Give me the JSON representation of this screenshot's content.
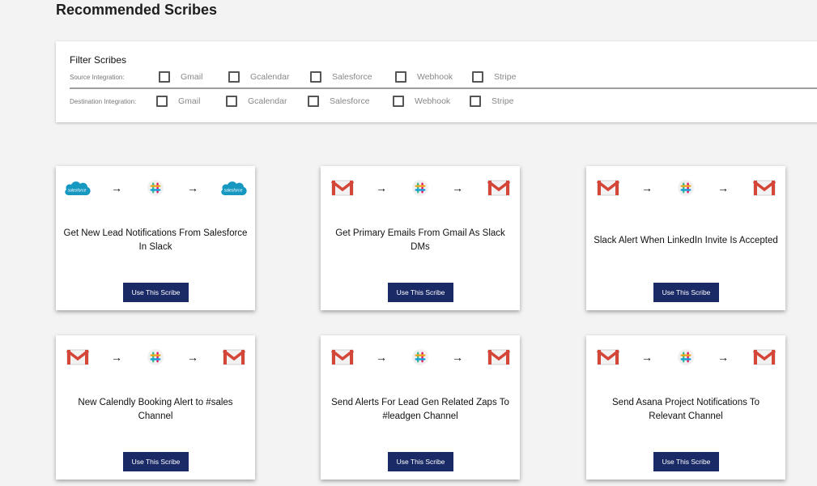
{
  "page": {
    "title": "Recommended Scribes"
  },
  "filters": {
    "title": "Filter Scribes",
    "source_label": "Source Integration:",
    "destination_label": "Destination Integration:",
    "options": [
      "Gmail",
      "Gcalendar",
      "Salesforce",
      "Webhook",
      "Stripe"
    ]
  },
  "cards": [
    {
      "title": "Get New Lead Notifications From Salesforce In Slack",
      "source_icon": "salesforce-logo",
      "middle_icon": "slack-logo",
      "dest_icon": "salesforce-logo",
      "source_text": "salesforce",
      "dest_text": "salesforce",
      "arrow": "→",
      "button": "Use This Scribe"
    },
    {
      "title": "Get Primary Emails From Gmail As Slack DMs",
      "source_icon": "gmail-logo",
      "middle_icon": "slack-logo",
      "dest_icon": "gmail-logo",
      "arrow": "→",
      "button": "Use This Scribe"
    },
    {
      "title": "Slack Alert When LinkedIn Invite Is Accepted",
      "source_icon": "gmail-logo",
      "middle_icon": "slack-logo",
      "dest_icon": "gmail-logo",
      "arrow": "→",
      "button": "Use This Scribe"
    },
    {
      "title": "New Calendly Booking Alert to #sales Channel",
      "source_icon": "gmail-logo",
      "middle_icon": "slack-logo",
      "dest_icon": "gmail-logo",
      "arrow": "→",
      "button": "Use This Scribe"
    },
    {
      "title": "Send Alerts For Lead Gen Related Zaps To #leadgen Channel",
      "source_icon": "gmail-logo",
      "middle_icon": "slack-logo",
      "dest_icon": "gmail-logo",
      "arrow": "→",
      "button": "Use This Scribe"
    },
    {
      "title": "Send Asana Project Notifications To Relevant Channel",
      "source_icon": "gmail-logo",
      "middle_icon": "slack-logo",
      "dest_icon": "gmail-logo",
      "arrow": "→",
      "button": "Use This Scribe"
    }
  ],
  "colors": {
    "button_bg": "#1a2a66",
    "salesforce": "#1798c1",
    "gmail_red": "#d44638",
    "page_bg": "#f3f3f3"
  }
}
